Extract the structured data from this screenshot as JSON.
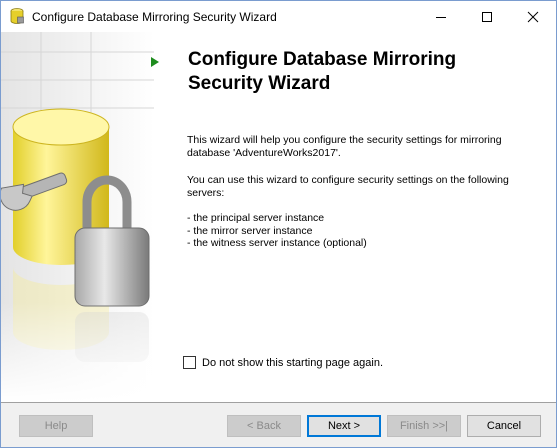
{
  "window": {
    "title": "Configure Database Mirroring Security Wizard"
  },
  "content": {
    "heading_line1": "Configure Database Mirroring",
    "heading_line2": "Security Wizard",
    "paragraph1": "This wizard will help you configure the security settings for mirroring database 'AdventureWorks2017'.",
    "paragraph2": "You can use this wizard to configure security settings on the following servers:",
    "bullets": [
      "- the principal server instance",
      "- the mirror server instance",
      "- the witness server instance (optional)"
    ],
    "checkbox_label": "Do not show this starting page again.",
    "checkbox_checked": false
  },
  "buttons": {
    "help": "Help",
    "back": "< Back",
    "next": "Next >",
    "finish": "Finish >>|",
    "cancel": "Cancel"
  },
  "icons": {
    "app": "database-icon",
    "arrow": "green-arrow-icon",
    "banner": "database-lock-wrench-illustration"
  },
  "colors": {
    "arrow_green": "#1e8c1e",
    "cylinder_yellow": "#e8d630",
    "default_button_border": "#0078d7"
  }
}
